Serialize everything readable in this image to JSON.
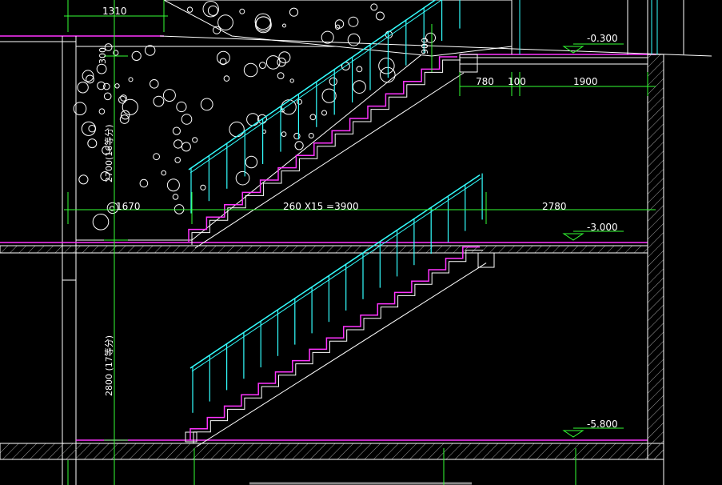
{
  "drawing": {
    "dimensions": {
      "top_width": "1310",
      "landing_offset": "300",
      "left_landing": "1670",
      "flight_run": "260 X15 =3900",
      "right_landing": "2780",
      "seg_a": "780",
      "seg_b": "100",
      "seg_c": "1900",
      "rail_height": "900",
      "upper_height": "2700(16等分)",
      "lower_height": "2800 (17等分)"
    },
    "levels": {
      "level_top": "-0.300",
      "level_mid": "-3.000",
      "level_bottom": "-5.800"
    },
    "colors": {
      "background": "#000000",
      "stair_steps": "#ff33ff",
      "handrail": "#33ffff",
      "dimension_lines": "#33ff33",
      "structure": "#ffffff",
      "hatch": "#a0a0a0"
    }
  }
}
